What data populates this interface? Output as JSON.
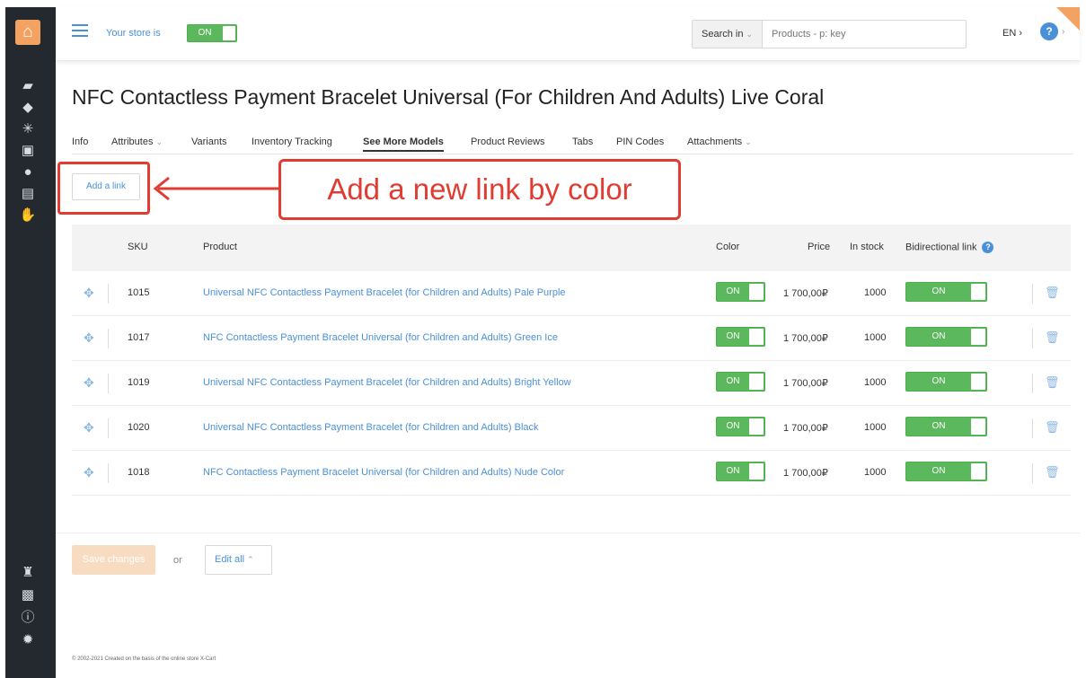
{
  "topbar": {
    "store_label": "Your store is",
    "store_toggle": "ON",
    "search_in": "Search in",
    "search_placeholder": "Products - p: key",
    "language": "EN"
  },
  "page_title": "NFC Contactless Payment Bracelet Universal (For Children And Adults) Live Coral",
  "tabs": [
    {
      "label": "Info"
    },
    {
      "label": "Attributes"
    },
    {
      "label": "Variants"
    },
    {
      "label": "Inventory Tracking"
    },
    {
      "label": "See More Models"
    },
    {
      "label": "Product Reviews"
    },
    {
      "label": "Tabs"
    },
    {
      "label": "PIN Codes"
    },
    {
      "label": "Attachments"
    }
  ],
  "add_link_label": "Add a link",
  "annotation_text": "Add a new link by color",
  "table": {
    "headers": {
      "sku": "SKU",
      "product": "Product",
      "color": "Color",
      "price": "Price",
      "stock": "In stock",
      "bidirectional": "Bidirectional link"
    },
    "rows": [
      {
        "sku": "1015",
        "product": "Universal NFC Contactless Payment Bracelet (for Children and Adults) Pale Purple",
        "color": "ON",
        "price": "1 700,00₽",
        "stock": "1000",
        "bidirectional": "ON"
      },
      {
        "sku": "1017",
        "product": "NFC Contactless Payment Bracelet Universal (for Children and Adults) Green Ice",
        "color": "ON",
        "price": "1 700,00₽",
        "stock": "1000",
        "bidirectional": "ON"
      },
      {
        "sku": "1019",
        "product": "Universal NFC Contactless Payment Bracelet (for Children and Adults) Bright Yellow",
        "color": "ON",
        "price": "1 700,00₽",
        "stock": "1000",
        "bidirectional": "ON"
      },
      {
        "sku": "1020",
        "product": "Universal NFC Contactless Payment Bracelet (for Children and Adults) Black",
        "color": "ON",
        "price": "1 700,00₽",
        "stock": "1000",
        "bidirectional": "ON"
      },
      {
        "sku": "1018",
        "product": "NFC Contactless Payment Bracelet Universal (for Children and Adults) Nude Color",
        "color": "ON",
        "price": "1 700,00₽",
        "stock": "1000",
        "bidirectional": "ON"
      }
    ]
  },
  "footer": {
    "save_label": "Save changes",
    "or_label": "or",
    "edit_all_label": "Edit all"
  },
  "copyright": "© 2002-2021 Created on the basis of the online store X-Cart",
  "colors": {
    "accent": "#4a90d9",
    "toggle_on": "#5cb85c",
    "annotation": "#e03c31",
    "sidebar": "#23292f",
    "save_button": "#f7dcc1"
  },
  "icons": [
    "store-logo-icon",
    "menu-icon",
    "tag-icon",
    "sun-icon",
    "gift-icon",
    "users-icon",
    "newspaper-icon",
    "handshake-icon",
    "sitemap-icon",
    "image-icon",
    "info-icon",
    "gear-icon",
    "drag-handle-icon",
    "trash-icon",
    "question-icon",
    "user-icon"
  ]
}
